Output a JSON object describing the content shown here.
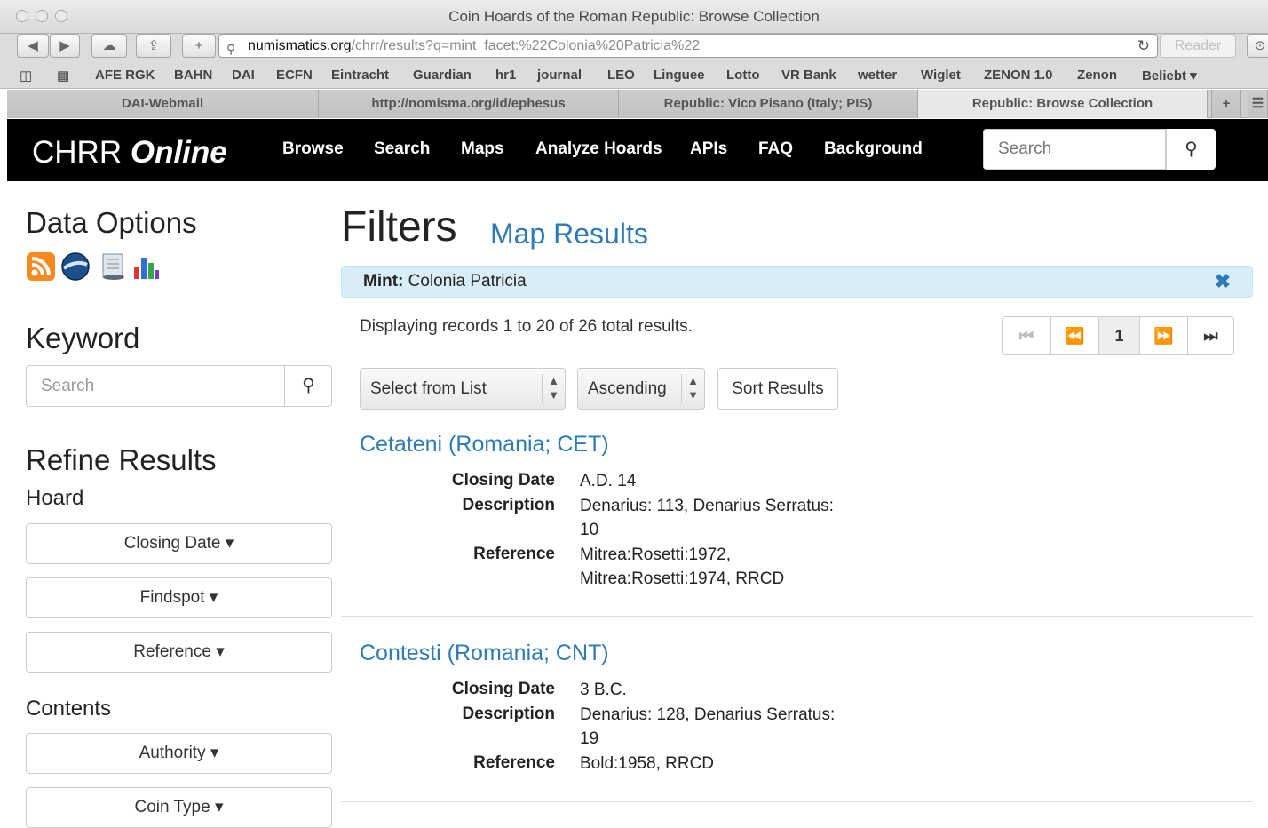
{
  "window": {
    "title": "Coin Hoards of the Roman Republic: Browse Collection"
  },
  "toolbar": {
    "url_domain": "numismatics.org",
    "url_rest": "/chrr/results?q=mint_facet:%22Colonia%20Patricia%22",
    "reader_label": "Reader"
  },
  "bookmarks": [
    "AFE RGK",
    "BAHN",
    "DAI",
    "ECFN",
    "Eintracht",
    "Guardian",
    "hr1",
    "journal",
    "LEO",
    "Linguee",
    "Lotto",
    "VR Bank",
    "wetter",
    "Wiglet",
    "ZENON 1.0",
    "Zenon",
    "Beliebt ▾"
  ],
  "tabs": [
    "DAI-Webmail",
    "http://nomisma.org/id/ephesus",
    "Republic: Vico Pisano (Italy; PIS)",
    "Republic: Browse Collection"
  ],
  "navbar": {
    "brand_main": "CHRR",
    "brand_ital": "Online",
    "links": [
      "Browse",
      "Search",
      "Maps",
      "Analyze Hoards",
      "APIs",
      "FAQ",
      "Background"
    ],
    "search_placeholder": "Search"
  },
  "sidebar": {
    "data_options_title": "Data Options",
    "keyword_title": "Keyword",
    "keyword_placeholder": "Search",
    "refine_title": "Refine Results",
    "hoard_title": "Hoard",
    "hoard_facets": [
      "Closing Date ▾",
      "Findspot ▾",
      "Reference ▾"
    ],
    "contents_title": "Contents",
    "contents_facets": [
      "Authority ▾",
      "Coin Type ▾"
    ]
  },
  "main": {
    "filters_title": "Filters",
    "map_results": "Map Results",
    "filter_label": "Mint:",
    "filter_value": "Colonia Patricia",
    "records_info": "Displaying records 1 to 20 of 26 total results.",
    "current_page": "1",
    "sort_field": "Select from List",
    "sort_order": "Ascending",
    "sort_button": "Sort Results",
    "results": [
      {
        "title": "Cetateni (Romania; CET)",
        "closing_date": "A.D. 14",
        "description": "Denarius: 113, Denarius Serratus: 10",
        "reference": "Mitrea:Rosetti:1972, Mitrea:Rosetti:1974, RRCD"
      },
      {
        "title": "Contesti (Romania; CNT)",
        "closing_date": "3 B.C.",
        "description": "Denarius: 128, Denarius Serratus: 19",
        "reference": "Bold:1958, RRCD"
      }
    ],
    "labels": {
      "closing_date": "Closing Date",
      "description": "Description",
      "reference": "Reference"
    }
  }
}
